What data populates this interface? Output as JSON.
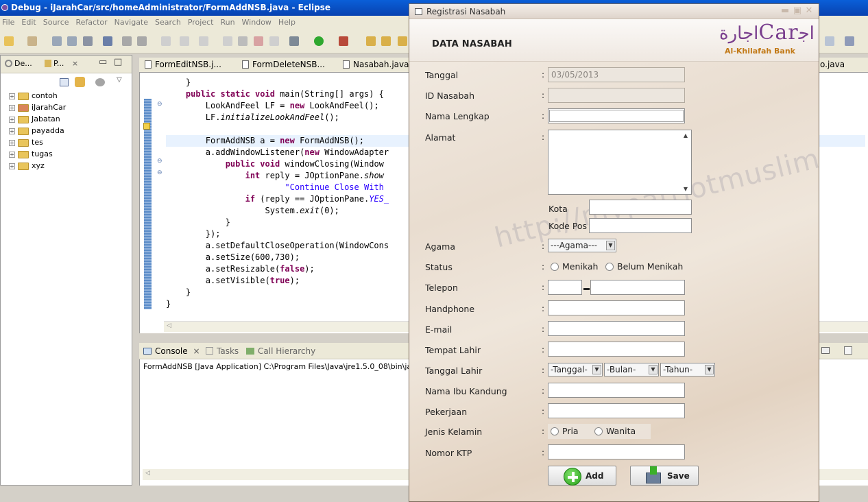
{
  "eclipse": {
    "title": "Debug - iJarahCar/src/homeAdministrator/FormAddNSB.java - Eclipse",
    "menu": [
      "File",
      "Edit",
      "Source",
      "Refactor",
      "Navigate",
      "Search",
      "Project",
      "Run",
      "Window",
      "Help"
    ],
    "left_tabs": [
      "De...",
      "P..."
    ],
    "tree": [
      "contoh",
      "iJarahCar",
      "Jabatan",
      "payadda",
      "tes",
      "tugas",
      "xyz"
    ],
    "editor_tabs": [
      "FormEditNSB.j...",
      "FormDeleteNSB...",
      "Nasabah.java",
      "o.java"
    ],
    "code_lines": [
      "    }",
      "",
      "    public static void main(String[] args) {",
      "        LookAndFeel LF = new LookAndFeel();",
      "        LF.initializeLookAndFeel();",
      "",
      "        FormAddNSB a = new FormAddNSB();",
      "        a.addWindowListener(new WindowAdapter",
      "            public void windowClosing(Window",
      "                int reply = JOptionPane.show",
      "                        \"Continue Close With",
      "                if (reply == JOptionPane.YES_",
      "                    System.exit(0);",
      "            }",
      "        });",
      "        a.setDefaultCloseOperation(WindowCons",
      "        a.setSize(600,730);",
      "        a.setResizable(false);",
      "        a.setVisible(true);",
      "    }",
      "}"
    ],
    "console_tabs": [
      "Console",
      "Tasks",
      "Call Hierarchy"
    ],
    "console_line": "FormAddNSB [Java Application] C:\\Program Files\\Java\\jre1.5.0_08\\bin\\javaw.ex"
  },
  "dialog": {
    "title": "Registrasi Nasabah",
    "header": "DATA NASABAH",
    "logo_text": "Car",
    "logo_sub": "Al-Khilafah Bank",
    "watermark": "http://mypatriotmuslim.blogspot.com",
    "labels": {
      "tanggal": "Tanggal",
      "id": "ID Nasabah",
      "nama": "Nama Lengkap",
      "alamat": "Alamat",
      "kota": "Kota",
      "kodepos": "Kode Pos",
      "agama": "Agama",
      "status": "Status",
      "telepon": "Telepon",
      "handphone": "Handphone",
      "email": "E-mail",
      "tempat_lahir": "Tempat Lahir",
      "tanggal_lahir": "Tanggal Lahir",
      "ibu": "Nama Ibu Kandung",
      "pekerjaan": "Pekerjaan",
      "jk": "Jenis Kelamin",
      "ktp": "Nomor KTP"
    },
    "colon": ":",
    "values": {
      "tanggal": "03/05/2013"
    },
    "agama_selected": "---Agama---",
    "status_options": [
      "Menikah",
      "Belum Menikah"
    ],
    "tgl_lahir_selects": [
      "-Tanggal-",
      "-Bulan-",
      "-Tahun-"
    ],
    "jk_options": [
      "Pria",
      "Wanita"
    ],
    "buttons": {
      "add": "Add",
      "save": "Save"
    },
    "colors": {
      "logo": "#7a3f8e",
      "logo_sub": "#c27a18"
    }
  }
}
